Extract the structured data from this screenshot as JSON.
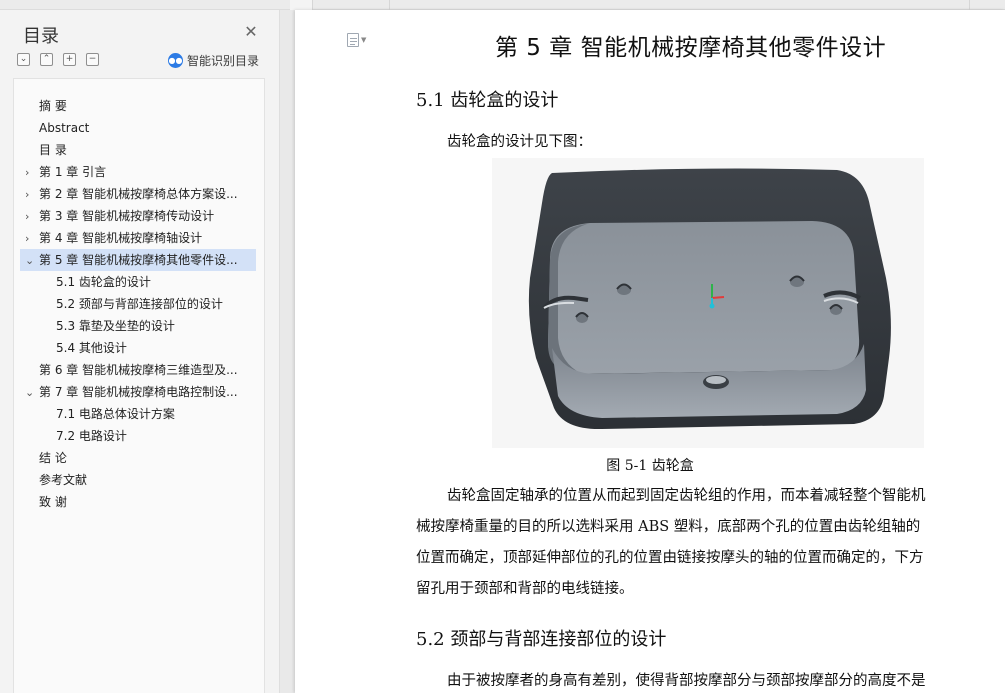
{
  "sidebar": {
    "title": "目录",
    "close_icon": "close-icon",
    "tools": [
      "⌄",
      "⌃",
      "+",
      "−"
    ],
    "smart_label": "智能识别目录",
    "items": [
      {
        "label": "摘  要",
        "arrow": ""
      },
      {
        "label": "Abstract",
        "arrow": ""
      },
      {
        "label": "目  录",
        "arrow": ""
      },
      {
        "label": "第 1 章 引言",
        "arrow": "›"
      },
      {
        "label": "第 2 章 智能机械按摩椅总体方案设...",
        "arrow": "›"
      },
      {
        "label": "第 3 章 智能机械按摩椅传动设计",
        "arrow": "›"
      },
      {
        "label": "第 4 章 智能机械按摩椅轴设计",
        "arrow": "›"
      },
      {
        "label": "第 5 章 智能机械按摩椅其他零件设...",
        "arrow": "⌄",
        "active": true
      },
      {
        "label": "5.1 齿轮盒的设计",
        "arrow": ""
      },
      {
        "label": "5.2 颈部与背部连接部位的设计",
        "arrow": ""
      },
      {
        "label": "5.3 靠垫及坐垫的设计",
        "arrow": ""
      },
      {
        "label": "5.4 其他设计",
        "arrow": ""
      },
      {
        "label": "第 6 章 智能机械按摩椅三维造型及...",
        "arrow": ""
      },
      {
        "label": "第 7 章 智能机械按摩椅电路控制设...",
        "arrow": "⌄"
      },
      {
        "label": "7.1 电路总体设计方案",
        "arrow": ""
      },
      {
        "label": "7.2 电路设计",
        "arrow": ""
      },
      {
        "label": "结  论",
        "arrow": ""
      },
      {
        "label": "参考文献",
        "arrow": ""
      },
      {
        "label": "致  谢",
        "arrow": ""
      }
    ]
  },
  "document": {
    "chapter_title": "第 5 章  智能机械按摩椅其他零件设计",
    "section_1_title": "5.1 齿轮盒的设计",
    "intro": "齿轮盒的设计见下图：",
    "figure_caption": "图 5-1 齿轮盒",
    "body_lines": [
      "齿轮盒固定轴承的位置从而起到固定齿轮组的作用，而本着减轻整个智能机",
      "械按摩椅重量的目的所以选料采用 ABS 塑料，底部两个孔的位置由齿轮组轴的",
      "位置而确定，顶部延伸部位的孔的位置由链接按摩头的轴的位置而确定的，下方",
      "留孔用于颈部和背部的电线链接。"
    ],
    "section_2_title": "5.2 颈部与背部连接部位的设计",
    "section_2_line": "由于被按摩者的身高有差别，使得背部按摩部分与颈部按摩部分的高度不是"
  },
  "colors": {
    "active_item_bg": "#d3e1f7",
    "accent_blue": "#2c7be5"
  }
}
